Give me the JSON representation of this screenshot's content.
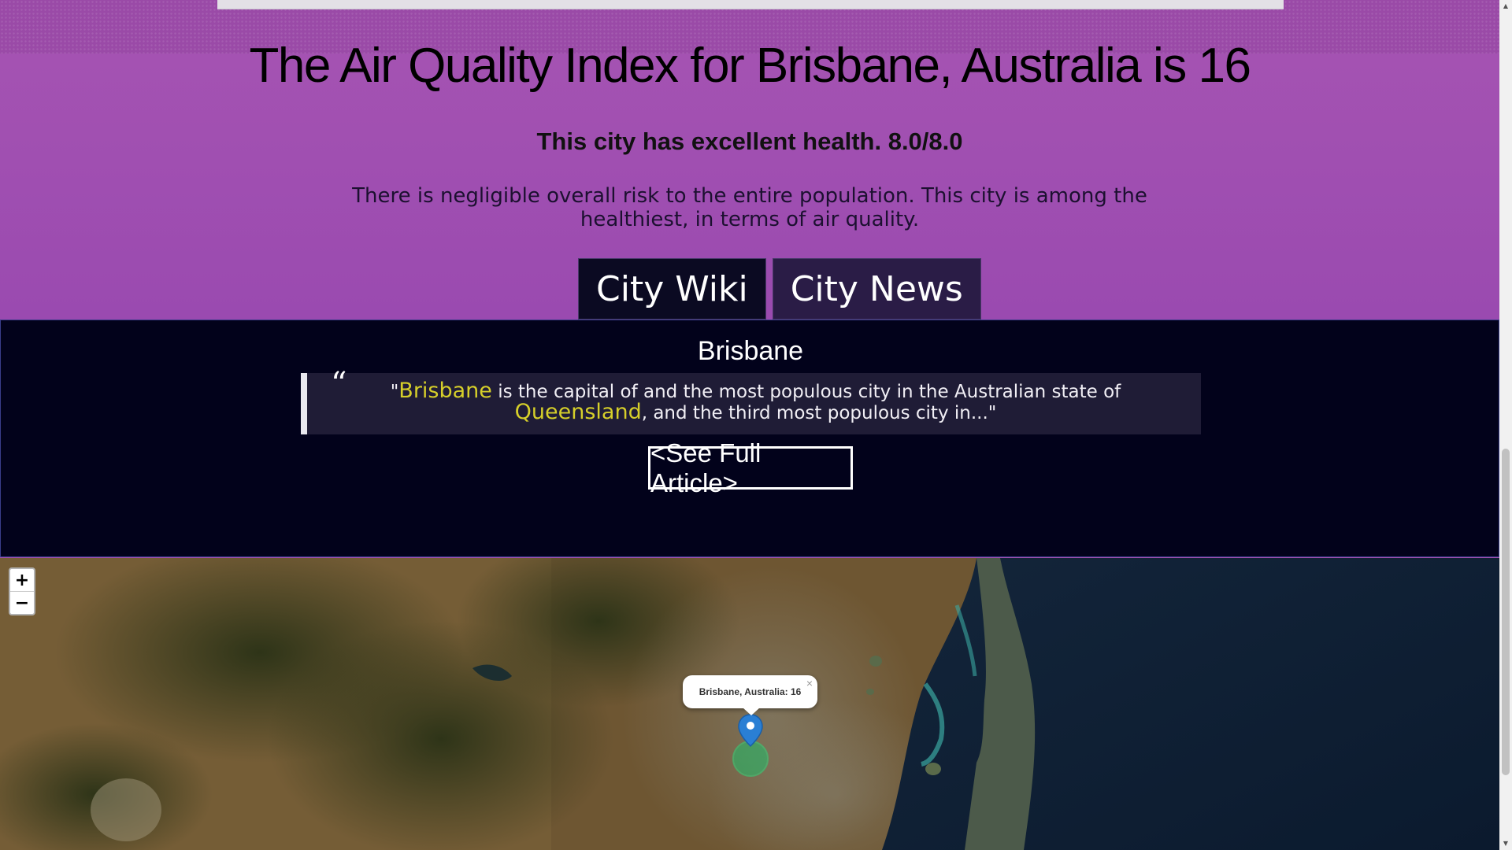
{
  "header": {
    "title": "The Air Quality Index for Brisbane, Australia is 16",
    "health": "This city has excellent health. 8.0/8.0",
    "risk": "There is negligible overall risk to the entire population. This city is among the healthiest, in terms of air quality."
  },
  "tabs": [
    {
      "label": "City Wiki",
      "active": true
    },
    {
      "label": "City News",
      "active": false
    }
  ],
  "wiki": {
    "heading": "Brisbane",
    "quote_open": "“",
    "quote_prefix": "\"",
    "link1": "Brisbane",
    "text1": " is the capital of and the most populous city in the Australian state of ",
    "link2": "Queensland",
    "text2": ", and the third most populous city in...\"",
    "button": "<See Full Article>"
  },
  "map": {
    "zoom_in": "+",
    "zoom_out": "−",
    "popup": "Brisbane, Australia: 16",
    "popup_close": "×",
    "marker_icon": "location-pin-icon"
  },
  "colors": {
    "hero_bg": "#a451b0",
    "panel_bg": "#02021b",
    "link_highlight": "#d6cf2a"
  }
}
